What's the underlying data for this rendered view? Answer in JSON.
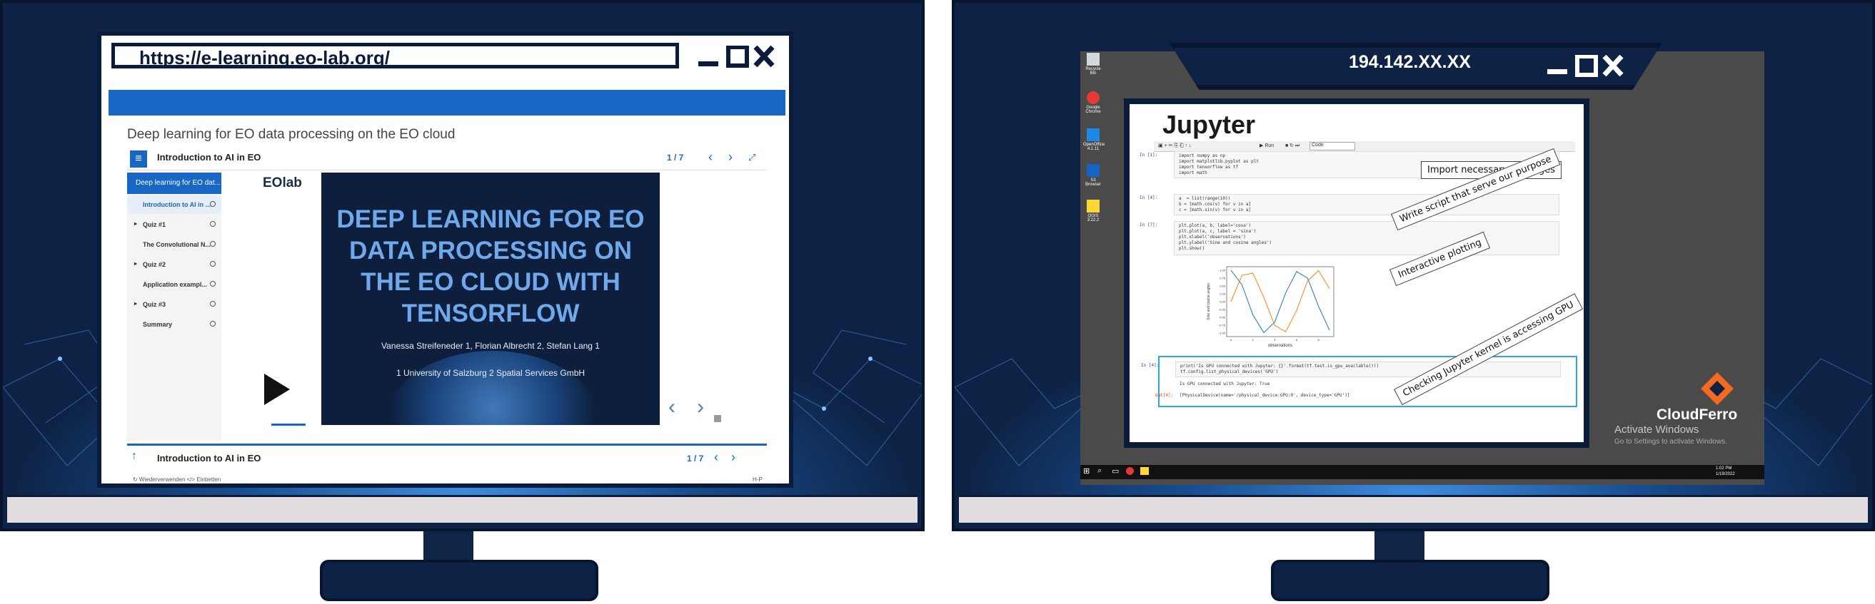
{
  "left": {
    "url": "https://e-learning.eo-lab.org/",
    "course_title": "Deep learning for EO data processing on the EO cloud",
    "module_title": "Introduction to AI in EO",
    "pager": "1 / 7",
    "sidebar": {
      "header": "Deep learning for EO dat...",
      "items": [
        {
          "label": "Introduction to AI in ...",
          "arrow": ""
        },
        {
          "label": "Quiz #1",
          "arrow": "▸"
        },
        {
          "label": "The Convolutional N...",
          "arrow": ""
        },
        {
          "label": "Quiz #2",
          "arrow": "▸"
        },
        {
          "label": "Application exampl...",
          "arrow": ""
        },
        {
          "label": "Quiz #3",
          "arrow": "▸"
        },
        {
          "label": "Summary",
          "arrow": ""
        }
      ]
    },
    "slide": {
      "logo": "EOlab",
      "title": "DEEP LEARNING FOR EO DATA PROCESSING ON THE EO CLOUD WITH TENSORFLOW",
      "authors": "Vanessa Streifeneder 1, Florian Albrecht 2, Stefan Lang 1",
      "affiliations": "1 University of Salzburg 2 Spatial Services GmbH"
    },
    "footer": {
      "title": "Introduction to AI in EO",
      "pager": "1 / 7",
      "links": "↻ Wiederverwenden   </> Einbetten",
      "right": "H-P"
    }
  },
  "right": {
    "ip": "194.142.XX.XX",
    "desktop_icons": [
      "Recycle Bin",
      "Google Chrome",
      "OpenOffice 4.1.11",
      "S3 Browser",
      "QGIS 3.22.2"
    ],
    "jupyter": {
      "logo": "Jupyter",
      "toolbar_run": "▶ Run",
      "toolbar_mode": "Code",
      "cells": [
        {
          "prompt": "In [1]:",
          "code": "import numpy as np\nimport matplotlib.pyplot as plt\nimport tensorflow as tf\nimport math"
        },
        {
          "prompt": "In [4]:",
          "code": "a  = list(range(10))\nb = [math.cos(v) for v in a]\nc = [math.sin(v) for v in a]"
        },
        {
          "prompt": "In [7]:",
          "code": "plt.plot(a, b, label='cosa')\nplt.plot(a, c, label = 'sina')\nplt.xlabel('observations')\nplt.ylabel('Sine and cosine angles')\nplt.show()"
        },
        {
          "prompt": "In [4]:",
          "code": "print('Is GPU connected with Jupyter: {}'.format(tf.test.is_gpu_available()))\ntf.config.list_physical_devices('GPU')"
        }
      ],
      "output_text": "Is GPU connected with Jupyter: True",
      "out_prompt": "Out[4]:",
      "out_value": "[PhysicalDevice(name='/physical_device:GPU:0', device_type='GPU')]"
    },
    "callouts": {
      "import": "Import necessary packages",
      "script": "Write script that serve our purpose",
      "plotting": "Interactive plotting",
      "gpu": "Checking Jupyter kernel is accessing GPU"
    },
    "activate": "Activate Windows",
    "activate_sub": "Go to Settings to activate Windows.",
    "brand": "CloudFerro",
    "clock": "1:02 PM\n1/19/2022"
  },
  "chart_data": {
    "type": "line",
    "x": [
      0,
      1,
      2,
      3,
      4,
      5,
      6,
      7,
      8,
      9
    ],
    "series": [
      {
        "name": "cosa",
        "values": [
          1.0,
          0.54,
          -0.42,
          -0.99,
          -0.65,
          0.28,
          0.96,
          0.75,
          -0.15,
          -0.91
        ],
        "color": "#1f77b4"
      },
      {
        "name": "sina",
        "values": [
          0.0,
          0.84,
          0.91,
          0.14,
          -0.76,
          -0.96,
          -0.28,
          0.66,
          0.99,
          0.41
        ],
        "color": "#ff7f0e"
      }
    ],
    "xlabel": "observations",
    "ylabel": "Sine and cosine angles",
    "xticks": [
      0,
      2,
      4,
      6,
      8
    ],
    "yticks": [
      "1.00",
      "0.75",
      "0.50",
      "0.25",
      "0.00",
      "-0.25",
      "-0.50",
      "-0.75",
      "-1.00"
    ],
    "ylim": [
      -1.0,
      1.0
    ],
    "grid": false
  }
}
